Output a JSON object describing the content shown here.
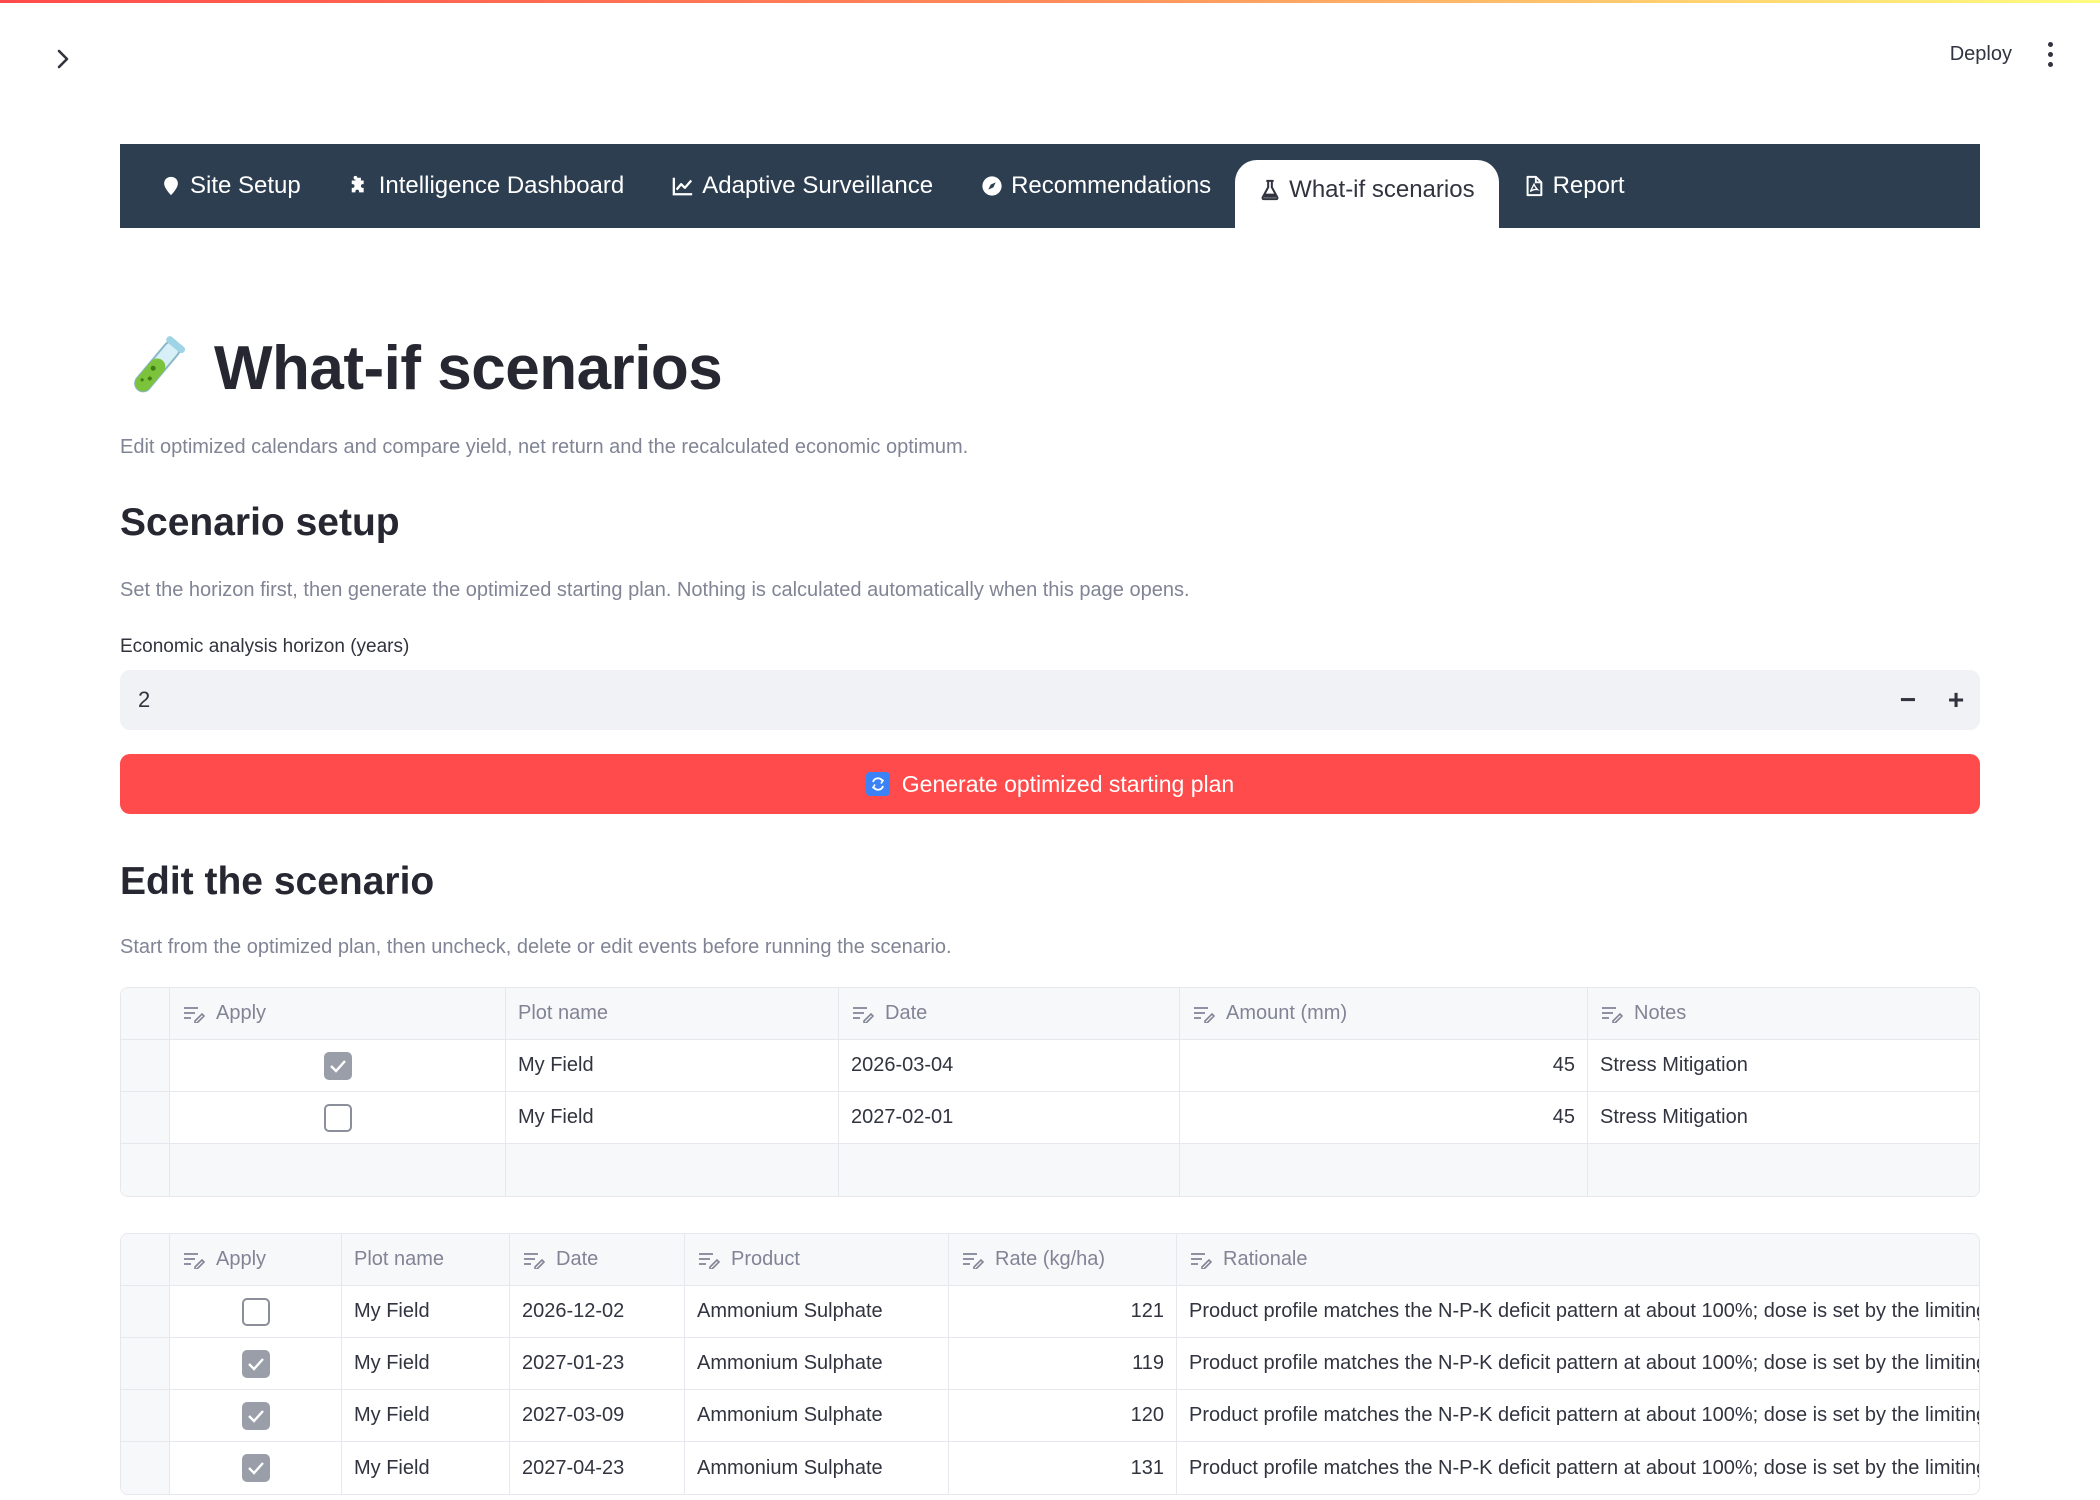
{
  "header": {
    "deploy_label": "Deploy"
  },
  "tabs": [
    {
      "label": "Site Setup",
      "icon": "map-pin-icon"
    },
    {
      "label": "Intelligence Dashboard",
      "icon": "puzzle-icon"
    },
    {
      "label": "Adaptive Surveillance",
      "icon": "chart-line-icon"
    },
    {
      "label": "Recommendations",
      "icon": "compass-icon"
    },
    {
      "label": "What-if scenarios",
      "icon": "flask-icon",
      "active": true
    },
    {
      "label": "Report",
      "icon": "pdf-file-icon"
    }
  ],
  "page": {
    "title": "What-if scenarios",
    "title_icon": "test-tube-icon",
    "subtitle": "Edit optimized calendars and compare yield, net return and the recalculated economic optimum."
  },
  "setup": {
    "heading": "Scenario setup",
    "caption": "Set the horizon first, then generate the optimized starting plan. Nothing is calculated automatically when this page opens.",
    "horizon_label": "Economic analysis horizon (years)",
    "horizon_value": "2",
    "minus": "−",
    "plus": "+",
    "generate_label": "Generate optimized starting plan"
  },
  "edit": {
    "heading": "Edit the scenario",
    "caption": "Start from the optimized plan, then uncheck, delete or edit events before running the scenario."
  },
  "irrigation": {
    "columns": [
      "Apply",
      "Plot name",
      "Date",
      "Amount (mm)",
      "Notes"
    ],
    "rows": [
      {
        "apply": true,
        "plot": "My Field",
        "date": "2026-03-04",
        "amount": "45",
        "notes": "Stress Mitigation"
      },
      {
        "apply": false,
        "plot": "My Field",
        "date": "2027-02-01",
        "amount": "45",
        "notes": "Stress Mitigation"
      }
    ]
  },
  "fertilizer": {
    "columns": [
      "Apply",
      "Plot name",
      "Date",
      "Product",
      "Rate (kg/ha)",
      "Rationale"
    ],
    "rows": [
      {
        "apply": false,
        "plot": "My Field",
        "date": "2026-12-02",
        "product": "Ammonium Sulphate",
        "rate": "121",
        "rationale": "Product profile matches the N-P-K deficit pattern at about 100%; dose is set by the limiting"
      },
      {
        "apply": true,
        "plot": "My Field",
        "date": "2027-01-23",
        "product": "Ammonium Sulphate",
        "rate": "119",
        "rationale": "Product profile matches the N-P-K deficit pattern at about 100%; dose is set by the limiting"
      },
      {
        "apply": true,
        "plot": "My Field",
        "date": "2027-03-09",
        "product": "Ammonium Sulphate",
        "rate": "120",
        "rationale": "Product profile matches the N-P-K deficit pattern at about 100%; dose is set by the limiting"
      },
      {
        "apply": true,
        "plot": "My Field",
        "date": "2027-04-23",
        "product": "Ammonium Sulphate",
        "rate": "131",
        "rationale": "Product profile matches the N-P-K deficit pattern at about 100%; dose is set by the limiting"
      }
    ]
  },
  "colors": {
    "accent": "#ff4b4b",
    "tabbar": "#2c3e50",
    "text": "#31333f",
    "muted": "#808495"
  }
}
